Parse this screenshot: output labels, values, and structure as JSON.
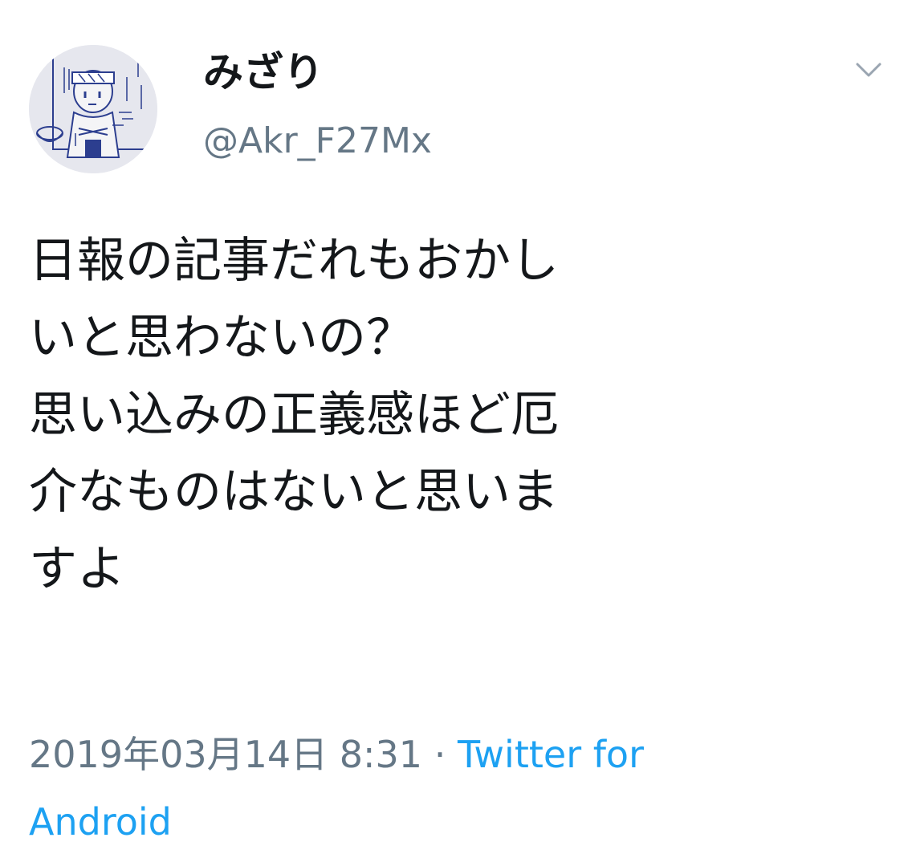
{
  "user": {
    "display_name": "みざり",
    "handle": "@Akr_F27Mx"
  },
  "tweet": {
    "lines": [
      "日報の記事だれもおかし",
      "いと思わないの？",
      "思い込みの正義感ほど厄",
      "介なものはないと思いま",
      "すよ"
    ]
  },
  "meta": {
    "timestamp": "2019年03月14日 8:31",
    "separator": "·",
    "source_line1": "Twitter for",
    "source_line2": "Android"
  },
  "icons": {
    "menu": "chevron-down-icon",
    "avatar": "profile-drawing"
  },
  "colors": {
    "text": "#14171a",
    "secondary": "#657786",
    "link": "#1da1f2"
  }
}
